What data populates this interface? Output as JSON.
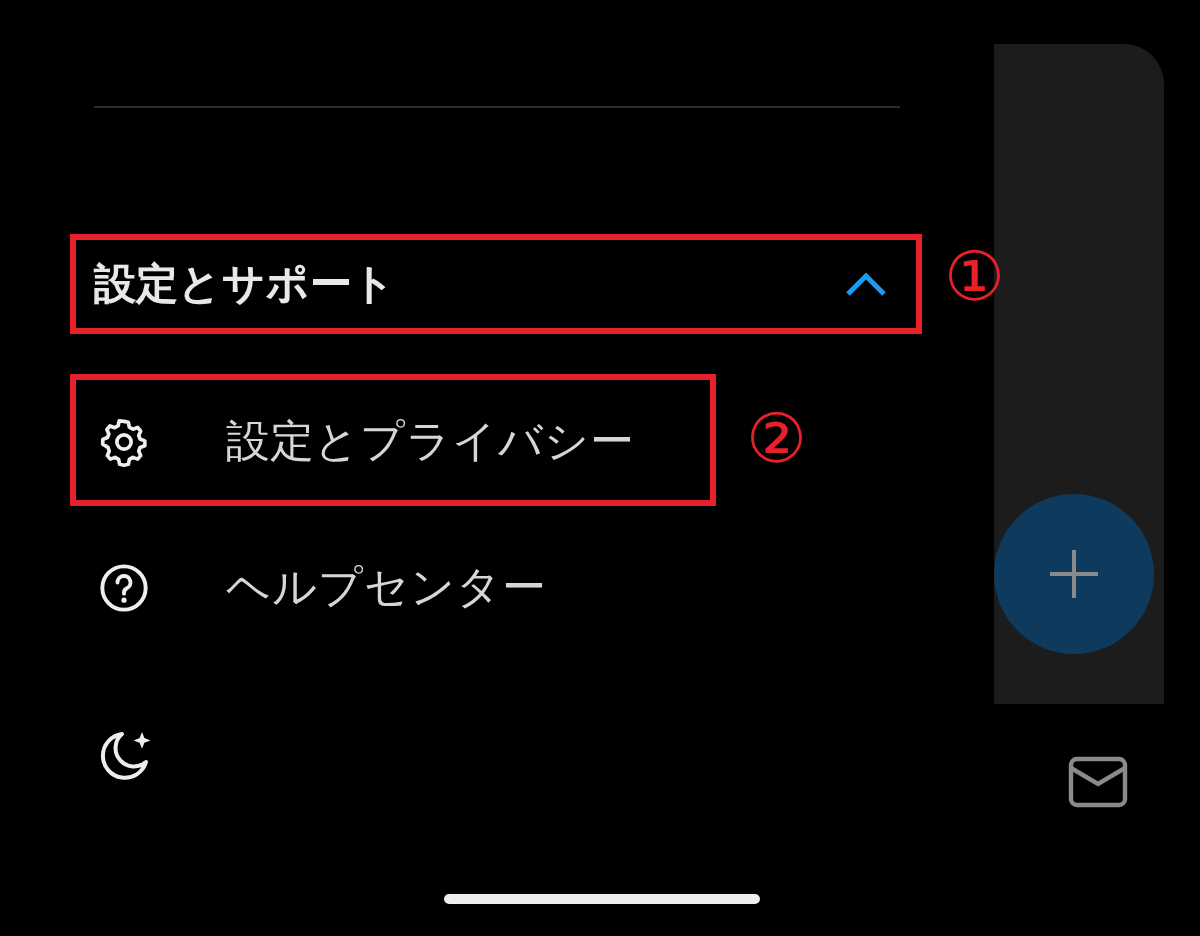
{
  "section": {
    "title": "設定とサポート",
    "expanded": true,
    "items": [
      {
        "kind": "settings",
        "label": "設定とプライバシー"
      },
      {
        "kind": "help",
        "label": "ヘルプセンター"
      }
    ]
  },
  "annotations": [
    {
      "label": "①"
    },
    {
      "label": "②"
    }
  ]
}
